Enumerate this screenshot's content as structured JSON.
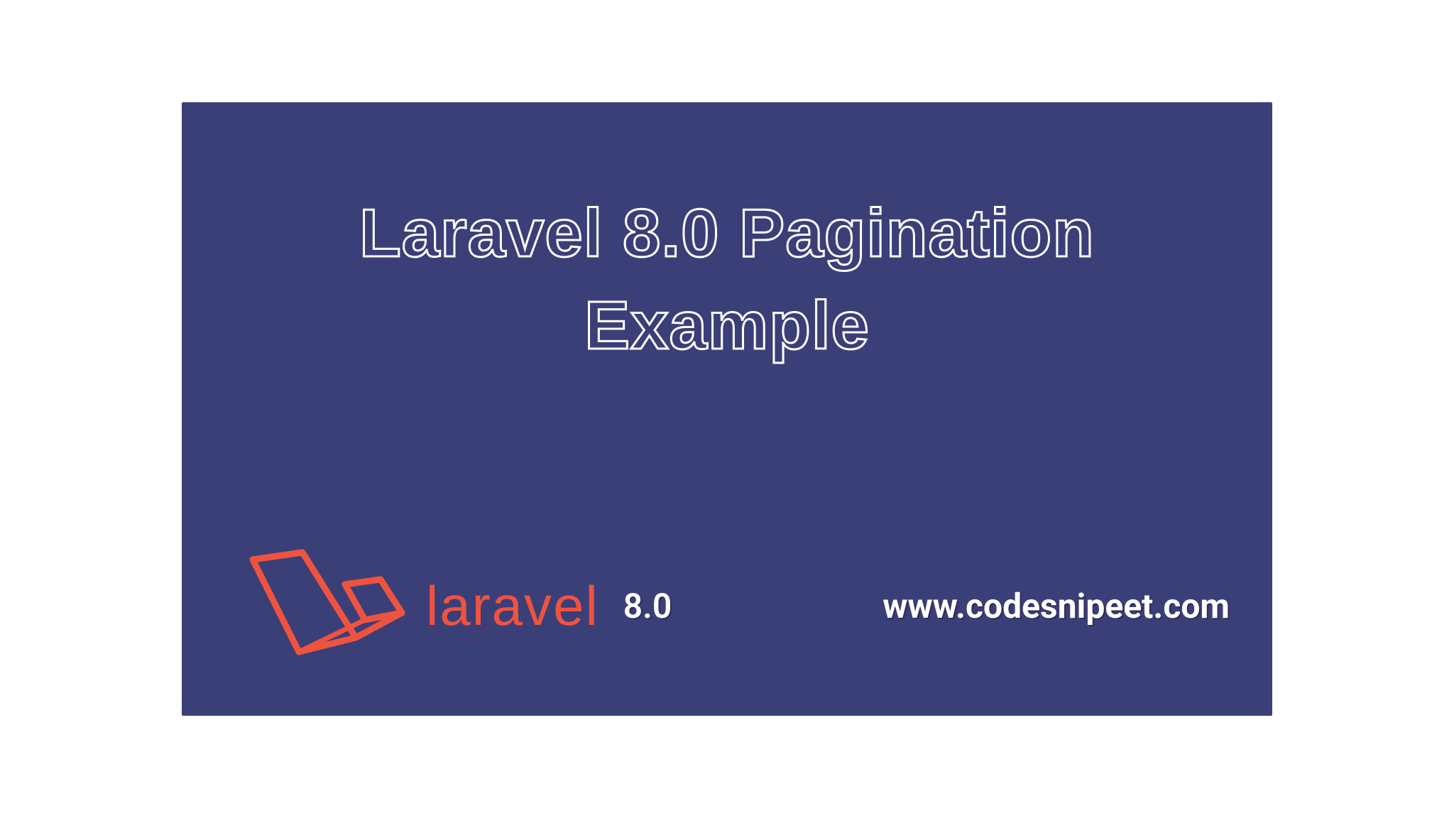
{
  "banner": {
    "title_line1": "Laravel 8.0 Pagination",
    "title_line2": "Example",
    "logo_text": "laravel",
    "version": "8.0",
    "website": "www.codesnipeet.com"
  },
  "colors": {
    "background": "#3b3f78",
    "accent": "#ef533f",
    "text": "#ffffff"
  }
}
